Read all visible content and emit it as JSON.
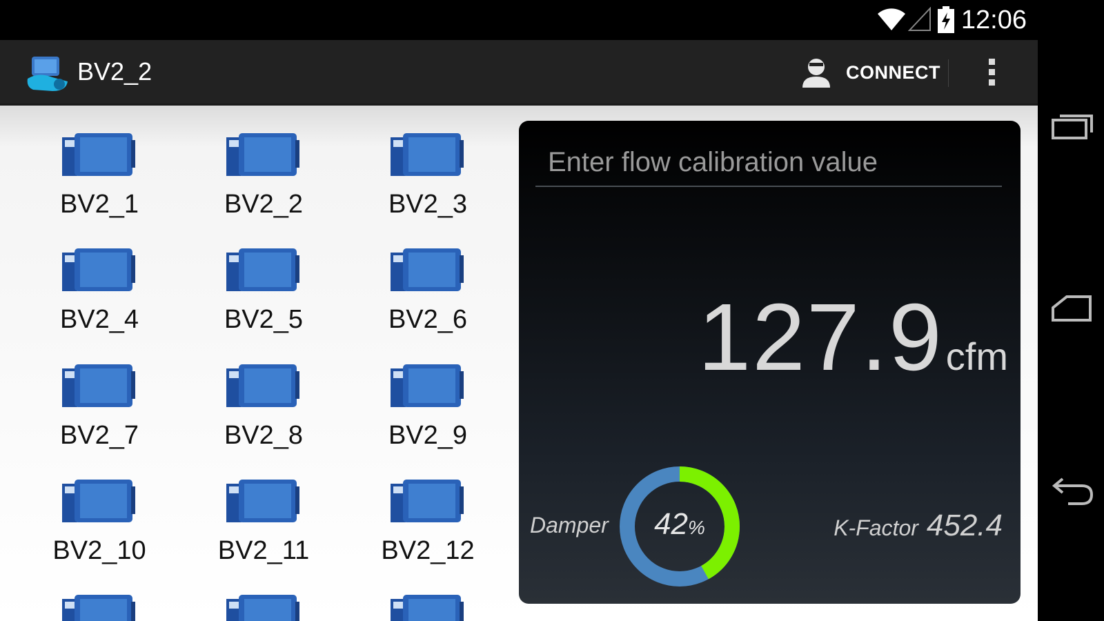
{
  "status_bar": {
    "time": "12:06"
  },
  "action_bar": {
    "title": "BV2_2",
    "connect_label": "CONNECT"
  },
  "devices": [
    {
      "label": "BV2_1"
    },
    {
      "label": "BV2_2"
    },
    {
      "label": "BV2_3"
    },
    {
      "label": "BV2_4"
    },
    {
      "label": "BV2_5"
    },
    {
      "label": "BV2_6"
    },
    {
      "label": "BV2_7"
    },
    {
      "label": "BV2_8"
    },
    {
      "label": "BV2_9"
    },
    {
      "label": "BV2_10"
    },
    {
      "label": "BV2_11"
    },
    {
      "label": "BV2_12"
    }
  ],
  "panel": {
    "calibration_placeholder": "Enter flow calibration value",
    "flow_value": "127.9",
    "flow_unit": "cfm",
    "damper_label": "Damper",
    "damper_percent": "42",
    "damper_percent_symbol": "%",
    "damper_fraction": 0.42,
    "kfactor_label": "K-Factor",
    "kfactor_value": "452.4"
  },
  "colors": {
    "gauge_fill": "#7cf000",
    "gauge_track": "#4a86c0",
    "device_blue": "#1f4fa0",
    "action_bar": "#222222"
  },
  "icons": {
    "status": [
      "wifi-icon",
      "signal-icon",
      "battery-icon"
    ],
    "nav": [
      "recent-apps-icon",
      "home-icon",
      "back-icon"
    ]
  }
}
